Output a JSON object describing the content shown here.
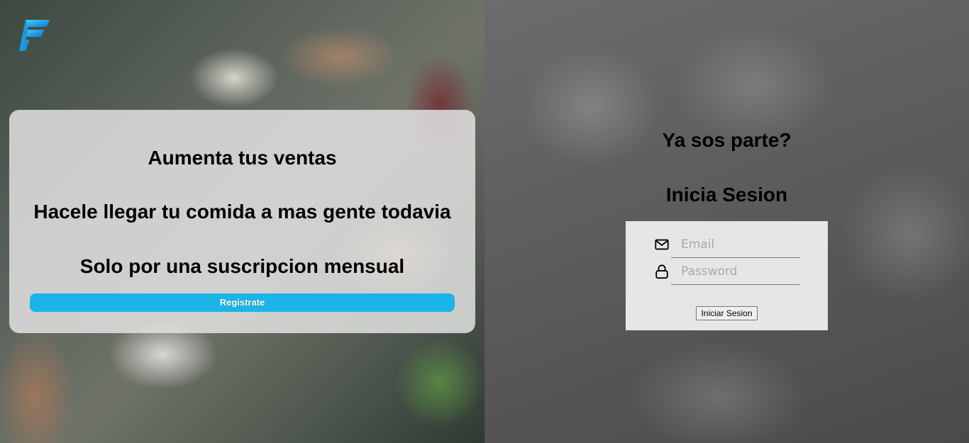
{
  "brand": {
    "logo_icon": "brand-f-logo-icon",
    "accent": "#1ab4e8"
  },
  "promo": {
    "line1": "Aumenta tus ventas",
    "line2": "Hacele llegar tu comida a mas gente todavia",
    "line3": "Solo por una suscripcion mensual",
    "register_label": "Registrate"
  },
  "login": {
    "heading": "Ya sos parte?",
    "subheading": "Inicia Sesion",
    "email_placeholder": "Email",
    "password_placeholder": "Password",
    "email_icon": "envelope-icon",
    "password_icon": "lock-icon",
    "submit_label": "Iniciar Sesion"
  }
}
